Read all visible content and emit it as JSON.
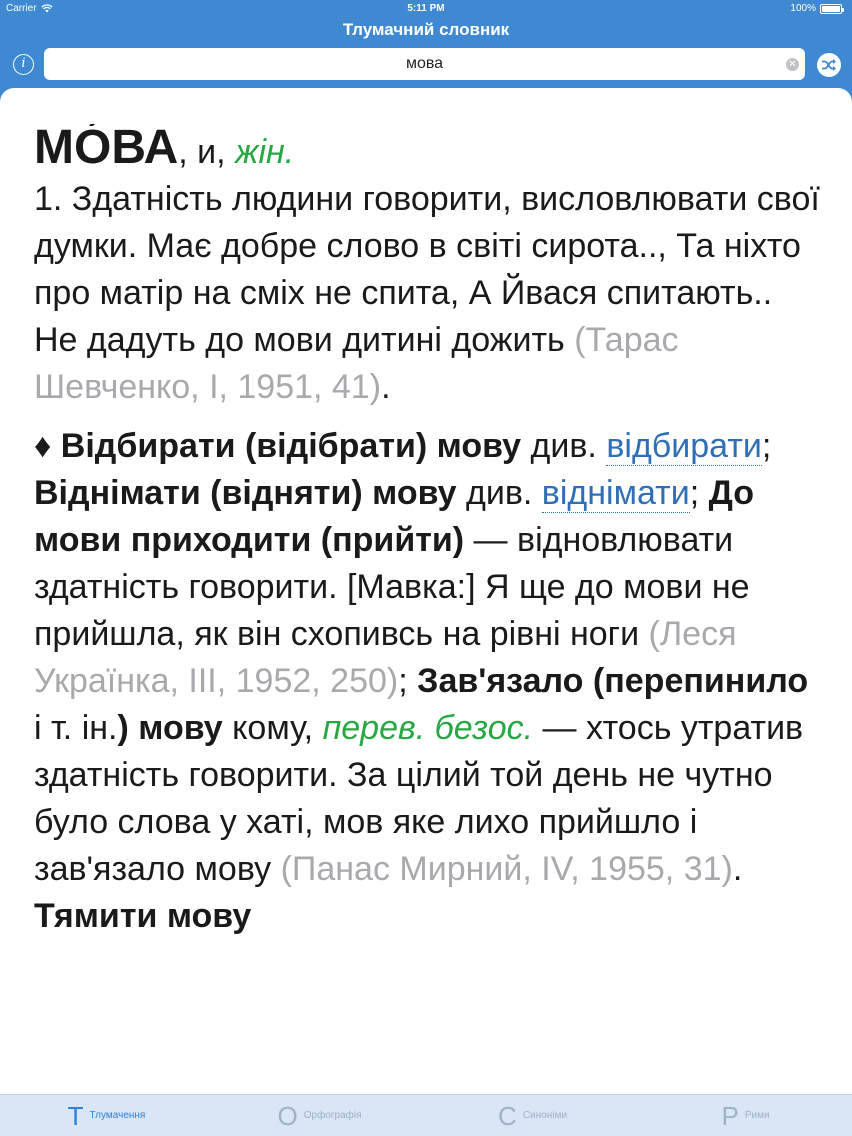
{
  "status": {
    "carrier": "Carrier",
    "time": "5:11 PM",
    "battery": "100%",
    "battery_level": 1.0
  },
  "nav": {
    "title": "Тлумачний словник",
    "search_value": "мова",
    "info_glyph": "i"
  },
  "entry": {
    "headword": "МО́ВА",
    "grammar": ", и, ",
    "gender": "жін.",
    "sense1": "1. Здатність людини говорити, висловлювати свої думки. Має добре слово в світі сирота.., Та ніхто про матір на сміх не спита, А Йвася спитають.. Не дадуть до мови дитині дожить ",
    "sense1_source": "(Тарас Шевченко, І, 1951, 41)",
    "sense1_end": ".",
    "phrase_marker": "♦ ",
    "phrase1": "Відбирати (відібрати) мову",
    "div1": " див. ",
    "xref1": "відбирати",
    "sep1": "; ",
    "phrase2": "Віднімати (відняти) мову",
    "div2": " див. ",
    "xref2": "віднімати",
    "sep2": "; ",
    "phrase3": "До мови приходити (прийти)",
    "def3": " — відновлювати здатність говорити. [Мавка:] Я ще до мови не прийшла, як він схопивсь на рівні ноги ",
    "src3": "(Леся Українка, ІІІ, 1952, 250)",
    "sep3": "; ",
    "phrase4a": "Зав'язало (перепинило",
    "phrase4mid": " і т. ін.",
    "phrase4b": ") мову",
    "phrase4rest": " кому, ",
    "label4": "перев. безос.",
    "def4": " — хтось утратив здатність говорити. За цілий той день не чутно було слова у хаті, мов яке лихо прийшло і зав'язало мову ",
    "src4": "(Панас Мирний, IV, 1955, 31)",
    "sep4": ". ",
    "phrase5": "Тямити мову"
  },
  "tabs": [
    {
      "letter": "Т",
      "label": "Тлумачення",
      "active": true
    },
    {
      "letter": "О",
      "label": "Орфографія",
      "active": false
    },
    {
      "letter": "С",
      "label": "Синоніми",
      "active": false
    },
    {
      "letter": "Р",
      "label": "Рими",
      "active": false
    }
  ]
}
